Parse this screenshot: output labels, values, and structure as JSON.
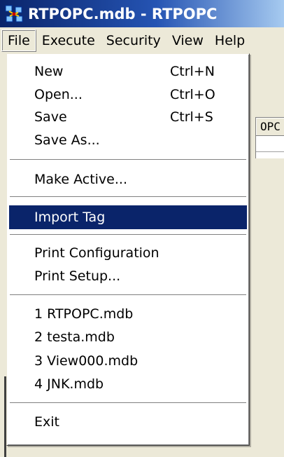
{
  "window": {
    "title": "RTPOPC.mdb - RTPOPC",
    "icon": "app-network-icon"
  },
  "menubar": {
    "items": [
      "File",
      "Execute",
      "Security",
      "View",
      "Help"
    ]
  },
  "background": {
    "column_header": "OPC"
  },
  "file_menu": {
    "new": {
      "label": "New",
      "shortcut": "Ctrl+N"
    },
    "open": {
      "label": "Open...",
      "shortcut": "Ctrl+O"
    },
    "save": {
      "label": "Save",
      "shortcut": "Ctrl+S"
    },
    "save_as": {
      "label": "Save As..."
    },
    "make_active": {
      "label": "Make Active..."
    },
    "import_tag": {
      "label": "Import Tag"
    },
    "print_configuration": {
      "label": "Print Configuration"
    },
    "print_setup": {
      "label": "Print Setup..."
    },
    "recent": [
      "1 RTPOPC.mdb",
      "2 testa.mdb",
      "3 View000.mdb",
      "4 JNK.mdb"
    ],
    "exit": {
      "label": "Exit"
    }
  },
  "colors": {
    "highlight": "#0a246a",
    "title_start": "#0a246a",
    "title_end": "#a6caf0",
    "menu_background": "#ece9d8"
  }
}
